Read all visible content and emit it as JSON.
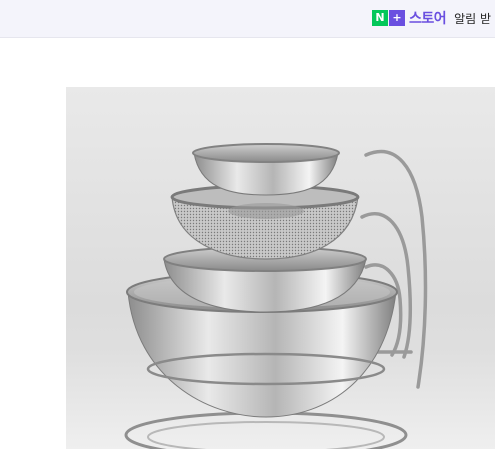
{
  "header": {
    "logo_n": "N",
    "logo_plus": "+",
    "store_label": "스토어",
    "alarm_label": "알림 받"
  },
  "product": {
    "image_subject": "stacked-stainless-bowls-and-strainer-on-stand"
  },
  "colors": {
    "header_bg": "#f4f4fb",
    "logo_green": "#03c75a",
    "logo_purple": "#6a4fe0",
    "photo_bg": "#e3e3e3"
  }
}
